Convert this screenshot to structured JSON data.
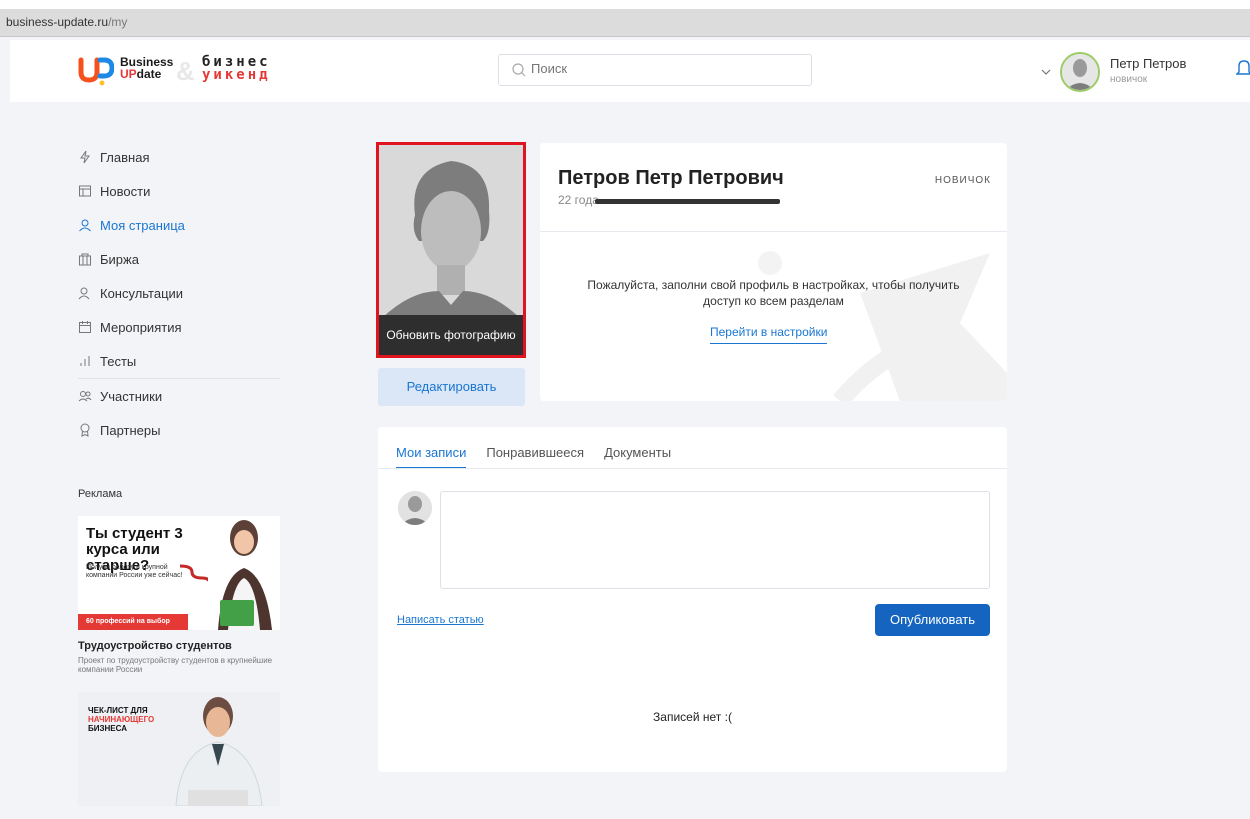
{
  "browser": {
    "url_host": "business-update.ru",
    "url_path": "/my"
  },
  "header": {
    "logo": {
      "business": "Business",
      "up": "UP",
      "date": "date",
      "ampersand": "&",
      "bw_line1": "бизнес",
      "bw_line2": "уикенд"
    },
    "search": {
      "placeholder": "Поиск",
      "icon": "search-icon"
    },
    "user": {
      "name": "Петр Петров",
      "role": "новичок"
    },
    "notifications_icon": "bell-icon"
  },
  "sidebar": {
    "items": [
      {
        "label": "Главная",
        "icon": "lightning-icon",
        "active": false
      },
      {
        "label": "Новости",
        "icon": "news-icon",
        "active": false
      },
      {
        "label": "Моя страница",
        "icon": "user-icon",
        "active": true
      },
      {
        "label": "Биржа",
        "icon": "exchange-icon",
        "active": false
      },
      {
        "label": "Консультации",
        "icon": "consult-icon",
        "active": false
      },
      {
        "label": "Мероприятия",
        "icon": "calendar-icon",
        "active": false
      },
      {
        "label": "Тесты",
        "icon": "chart-icon",
        "active": false
      },
      {
        "label": "Участники",
        "icon": "users-icon",
        "active": false
      },
      {
        "label": "Партнеры",
        "icon": "award-icon",
        "active": false
      }
    ],
    "ads_title": "Реклама",
    "ad1": {
      "headline": "Ты студент 3 курса или старше?",
      "subline": "Получи работу в крупной компании России уже сейчас!",
      "badge": "60 профессий на выбор",
      "title": "Трудоустройство студентов",
      "description": "Проект по трудоустройству студентов в крупнейшие компании России"
    },
    "ad2": {
      "line1": "ЧЕК-ЛИСТ ДЛЯ",
      "line2": "НАЧИНАЮЩЕГО",
      "line3": "БИЗНЕСА"
    }
  },
  "profile": {
    "update_photo": "Обновить фотографию",
    "edit": "Редактировать",
    "full_name": "Петров Петр Петрович",
    "age": "22 года",
    "level": "НОВИЧОК",
    "message": "Пожалуйста, заполни свой профиль в настройках, чтобы получить доступ ко всем разделам",
    "settings_link": "Перейти в настройки"
  },
  "feed": {
    "tabs": [
      {
        "label": "Мои записи",
        "active": true
      },
      {
        "label": "Понравившееся",
        "active": false
      },
      {
        "label": "Документы",
        "active": false
      }
    ],
    "write_article": "Написать статью",
    "publish": "Опубликовать",
    "empty": "Записей нет :("
  },
  "colors": {
    "accent": "#1976d2",
    "brand_red": "#e53935",
    "highlight": "#e0141e",
    "background": "#f2f4f8"
  }
}
